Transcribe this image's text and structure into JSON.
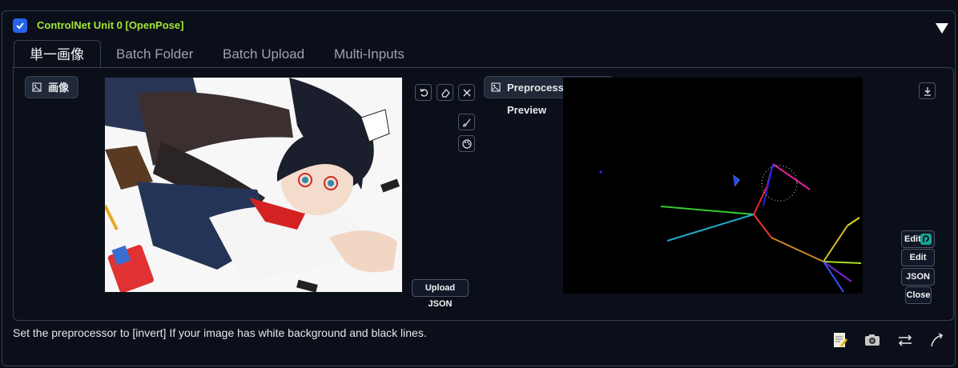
{
  "unit": {
    "title": "ControlNet Unit 0  [OpenPose]",
    "enabled": true
  },
  "tabs": [
    {
      "label": "単一画像",
      "active": true
    },
    {
      "label": "Batch Folder",
      "active": false
    },
    {
      "label": "Batch Upload",
      "active": false
    },
    {
      "label": "Multi-Inputs",
      "active": false
    }
  ],
  "input": {
    "label": "画像"
  },
  "preview": {
    "label": "Preprocessor Preview"
  },
  "buttons": {
    "upload_json": "Upload JSON",
    "edit_photopea": "Edit",
    "edit": "Edit",
    "json": "JSON",
    "close": "Close"
  },
  "hint": "Set the preprocessor to [invert] If your image has white background and black lines.",
  "icons": {
    "tools": [
      "memo-icon",
      "camera-icon",
      "swap-arrows-icon",
      "curved-arrow-icon"
    ],
    "image_tools": [
      "undo-icon",
      "eraser-icon",
      "close-icon",
      "brush-icon",
      "palette-icon"
    ]
  },
  "colors": {
    "accent": "#2563eb",
    "title": "#a3e635",
    "background": "#0b0f19"
  }
}
